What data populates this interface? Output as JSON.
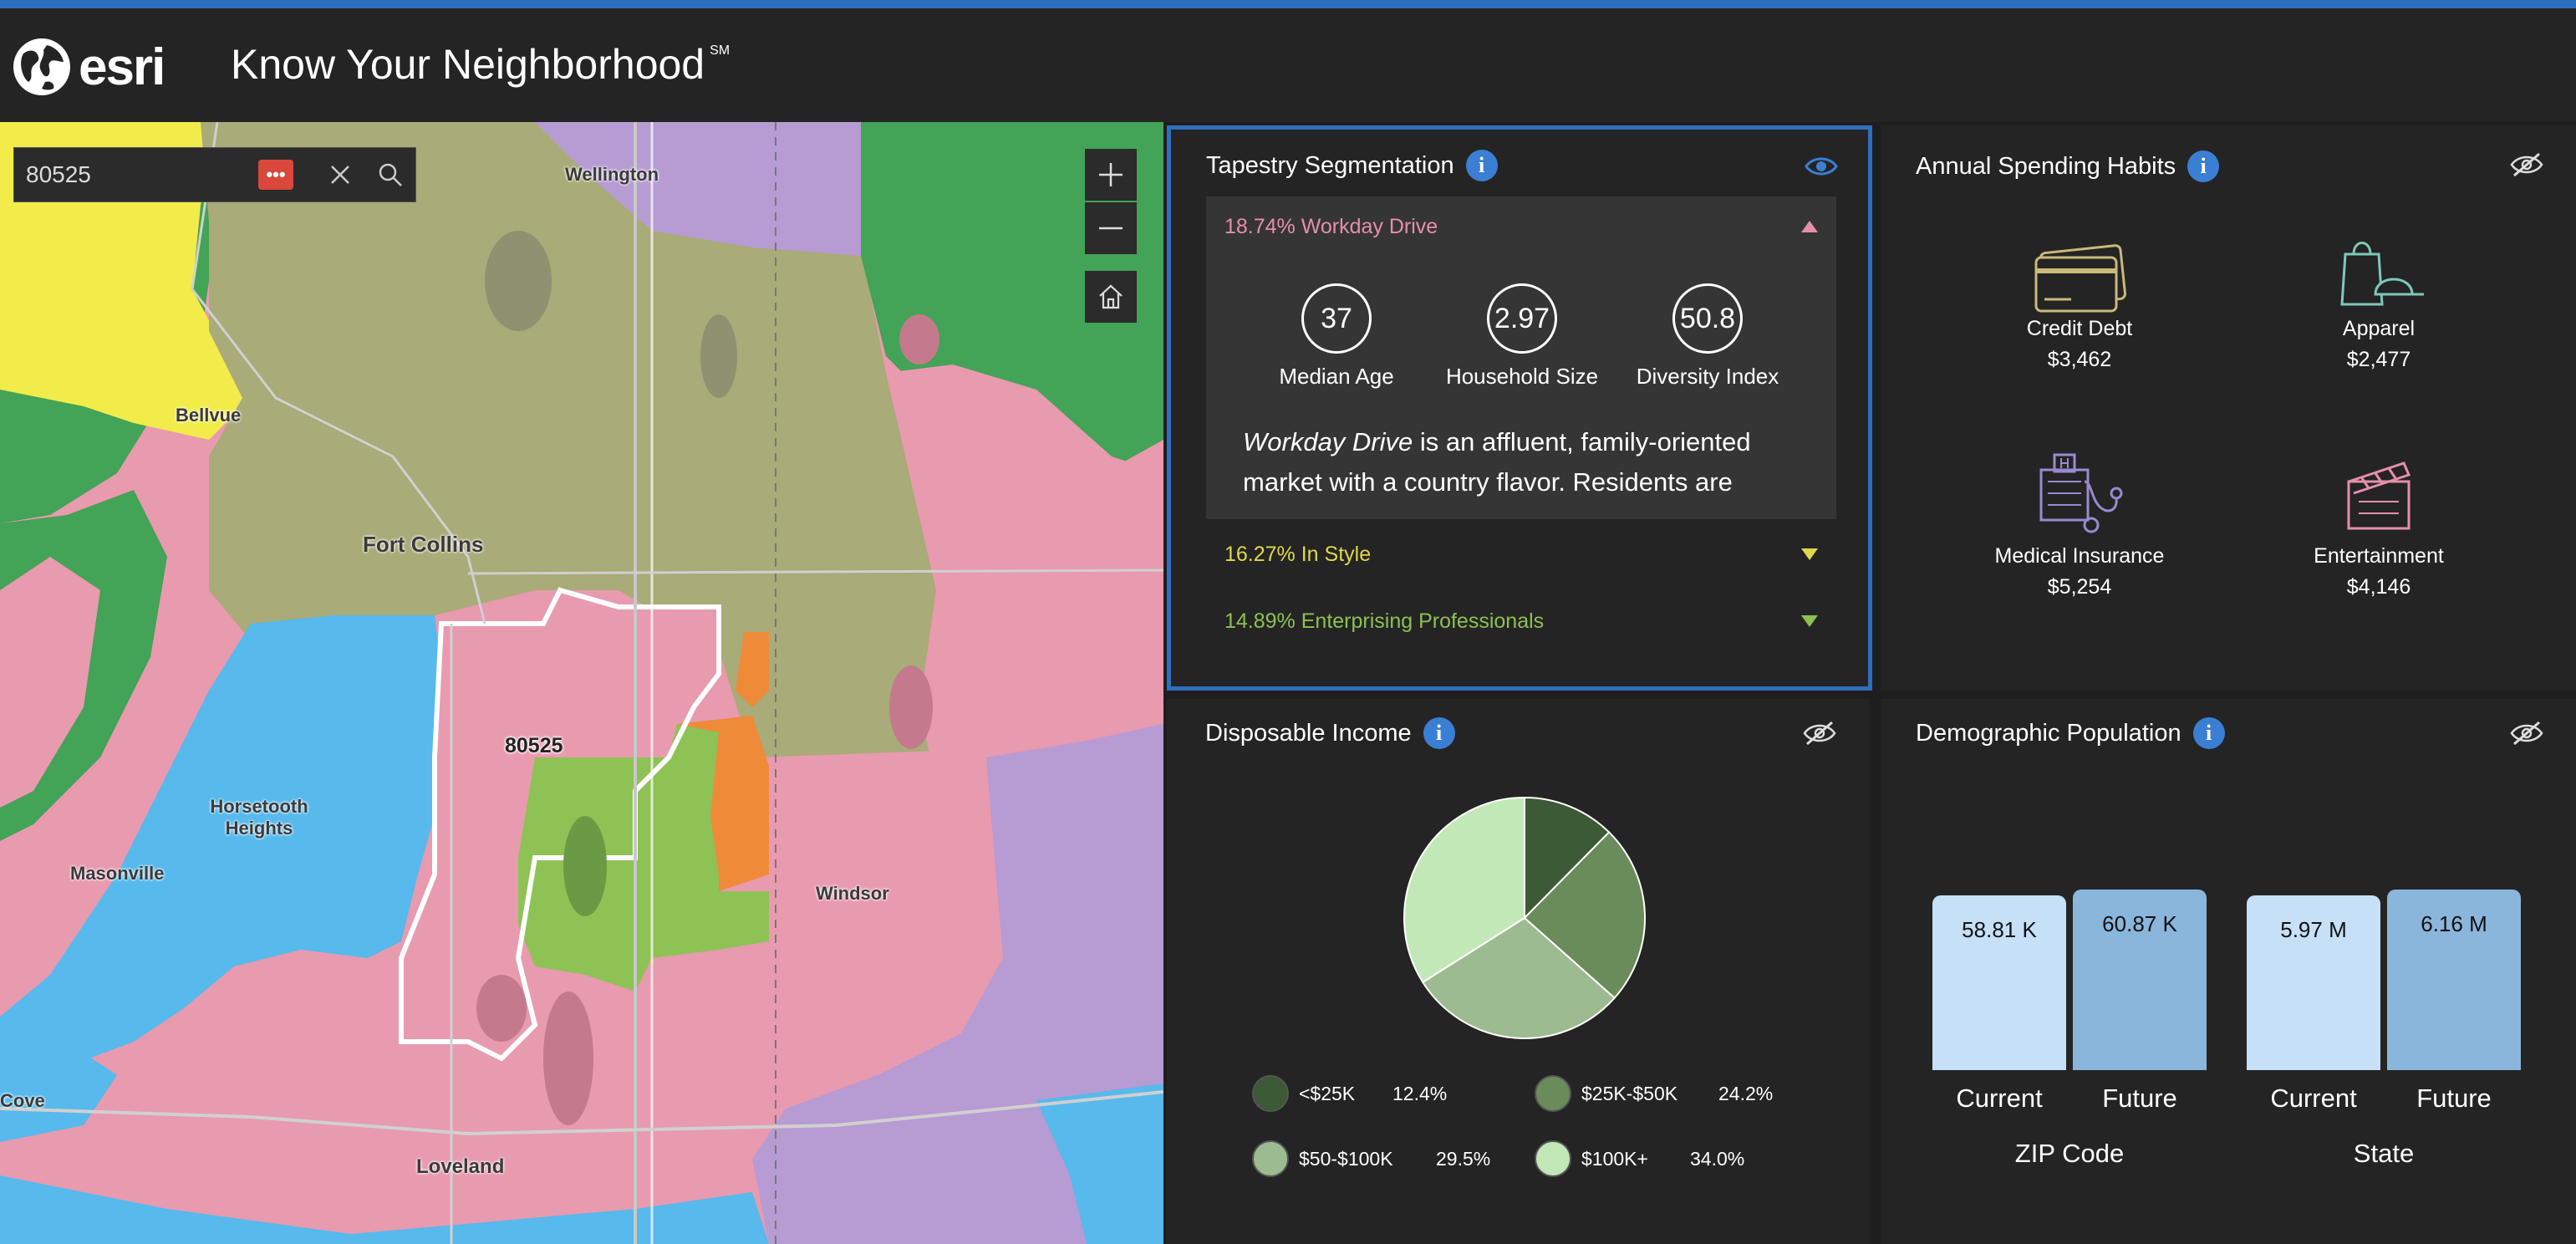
{
  "app": {
    "logo_text": "esri",
    "title": "Know Your Neighborhood",
    "title_mark": "SM"
  },
  "map": {
    "search_value": "80525",
    "search_badge": "•••",
    "labels": {
      "wellington": "Wellington",
      "bellvue": "Bellvue",
      "fort_collins": "Fort Collins",
      "horsetooth": "Horsetooth Heights",
      "masonville": "Masonville",
      "windsor": "Windsor",
      "cove": "Cove",
      "loveland": "Loveland",
      "zip": "80525"
    },
    "icons": {
      "zoom_in": "plus-icon",
      "zoom_out": "minus-icon",
      "home": "home-icon",
      "search": "search-icon",
      "clear": "close-icon"
    }
  },
  "tapestry": {
    "title": "Tapestry Segmentation",
    "segments": [
      {
        "label": "18.74% Workday Drive",
        "color": "#e58fa8",
        "expanded": true
      },
      {
        "label": "16.27% In Style",
        "color": "#e0d84a",
        "expanded": false
      },
      {
        "label": "14.89% Enterprising Professionals",
        "color": "#8cc152",
        "expanded": false
      }
    ],
    "stats": [
      {
        "value": "37",
        "label": "Median Age"
      },
      {
        "value": "2.97",
        "label": "Household Size"
      },
      {
        "value": "50.8",
        "label": "Diversity Index"
      }
    ],
    "description_name": "Workday Drive",
    "description_rest": " is an affluent, family-oriented market with a country flavor. Residents are"
  },
  "spending": {
    "title": "Annual Spending Habits",
    "items": [
      {
        "label": "Credit Debt",
        "value": "$3,462",
        "icon": "credit-card-icon",
        "color": "#c9b97a"
      },
      {
        "label": "Apparel",
        "value": "$2,477",
        "icon": "apparel-icon",
        "color": "#7fc8b8"
      },
      {
        "label": "Medical Insurance",
        "value": "$5,254",
        "icon": "medical-icon",
        "color": "#9a8ad0"
      },
      {
        "label": "Entertainment",
        "value": "$4,146",
        "icon": "clapperboard-icon",
        "color": "#e58fa8"
      }
    ]
  },
  "disposable": {
    "title": "Disposable Income",
    "legend": [
      {
        "label": "<$25K",
        "value": "12.4%",
        "color": "#3b5a35"
      },
      {
        "label": "$25K-$50K",
        "value": "24.2%",
        "color": "#6a8c5a"
      },
      {
        "label": "$50-$100K",
        "value": "29.5%",
        "color": "#9dbb90"
      },
      {
        "label": "$100K+",
        "value": "34.0%",
        "color": "#c3e8b8"
      }
    ]
  },
  "demographic": {
    "title": "Demographic Population",
    "groups": [
      {
        "label": "ZIP Code",
        "bars": [
          {
            "label": "Current",
            "value_text": "58.81 K",
            "value": 58.81
          },
          {
            "label": "Future",
            "value_text": "60.87 K",
            "value": 60.87
          }
        ]
      },
      {
        "label": "State",
        "bars": [
          {
            "label": "Current",
            "value_text": "5.97 M",
            "value": 5.97
          },
          {
            "label": "Future",
            "value_text": "6.16 M",
            "value": 6.16
          }
        ]
      }
    ]
  },
  "chart_data": [
    {
      "type": "pie",
      "categories": [
        "<$25K",
        "$25K-$50K",
        "$50-$100K",
        "$100K+"
      ],
      "values": [
        12.4,
        24.2,
        29.5,
        34.0
      ],
      "colors": [
        "#3b5a35",
        "#6a8c5a",
        "#9dbb90",
        "#c3e8b8"
      ]
    },
    {
      "type": "bar",
      "categories": [
        "Current",
        "Future"
      ],
      "series": [
        {
          "name": "ZIP Code",
          "values": [
            58.81,
            60.87
          ]
        }
      ],
      "data_labels": [
        "58.81 K",
        "60.87 K"
      ],
      "xlabel": "ZIP Code"
    },
    {
      "type": "bar",
      "categories": [
        "Current",
        "Future"
      ],
      "series": [
        {
          "name": "State",
          "values": [
            5.97,
            6.16
          ]
        }
      ],
      "data_labels": [
        "5.97 M",
        "6.16 M"
      ],
      "xlabel": "State"
    }
  ]
}
